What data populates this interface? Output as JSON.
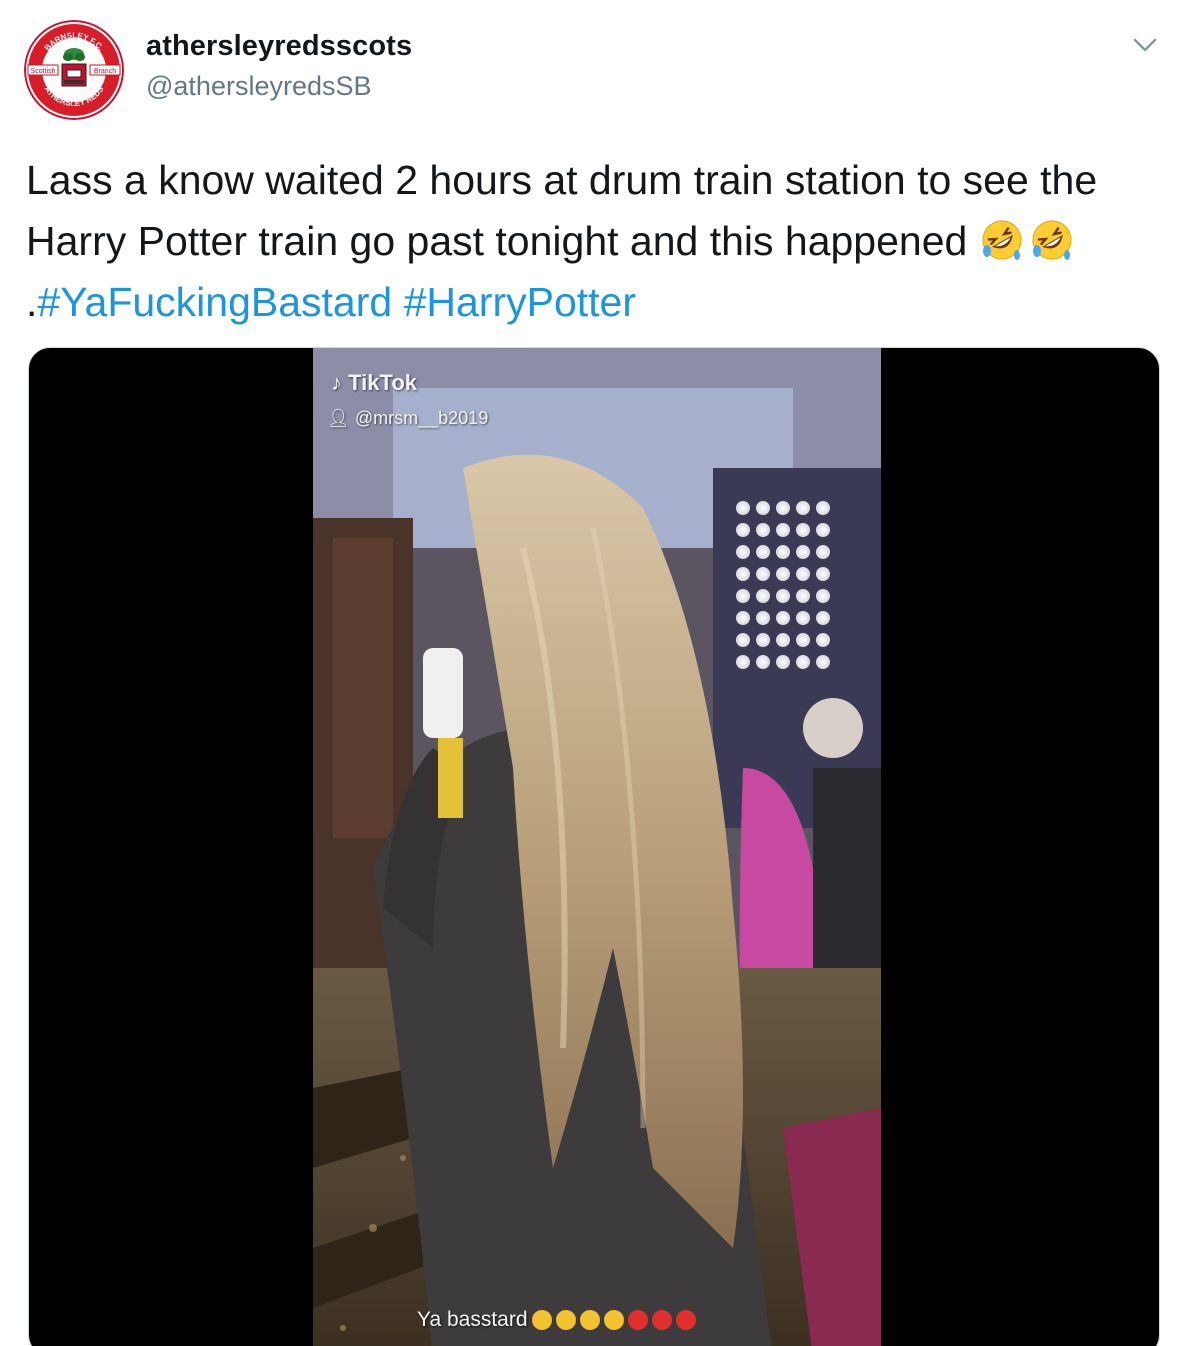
{
  "user": {
    "display_name": "athersleyredsscots",
    "handle": "@athersleyredsSB",
    "avatar_text": {
      "top": "BARNSLEY F.C.",
      "left": "Scottish",
      "right": "Branch",
      "bottom": "ATHERSLEY REDS"
    }
  },
  "tweet": {
    "text_part1": "Lass a know waited 2 hours at drum train station to see the Harry Potter train go past tonight and this happened ",
    "emojis": [
      "rolling-on-floor-laughing",
      "rolling-on-floor-laughing"
    ],
    "separator": ".",
    "hashtags": [
      "#YaFuckingBastard",
      "#HarryPotter"
    ]
  },
  "video": {
    "watermark_app": "TikTok",
    "watermark_user": "@mrsm__b2019",
    "caption_text": "Ya basstard",
    "caption_emojis": [
      "laughing",
      "laughing",
      "laughing",
      "laughing",
      "red",
      "red",
      "red"
    ]
  },
  "colors": {
    "link": "#1b95e0",
    "secondary_text": "#657786",
    "video_bg": "#000000"
  },
  "icons": {
    "menu": "chevron-down-icon"
  }
}
